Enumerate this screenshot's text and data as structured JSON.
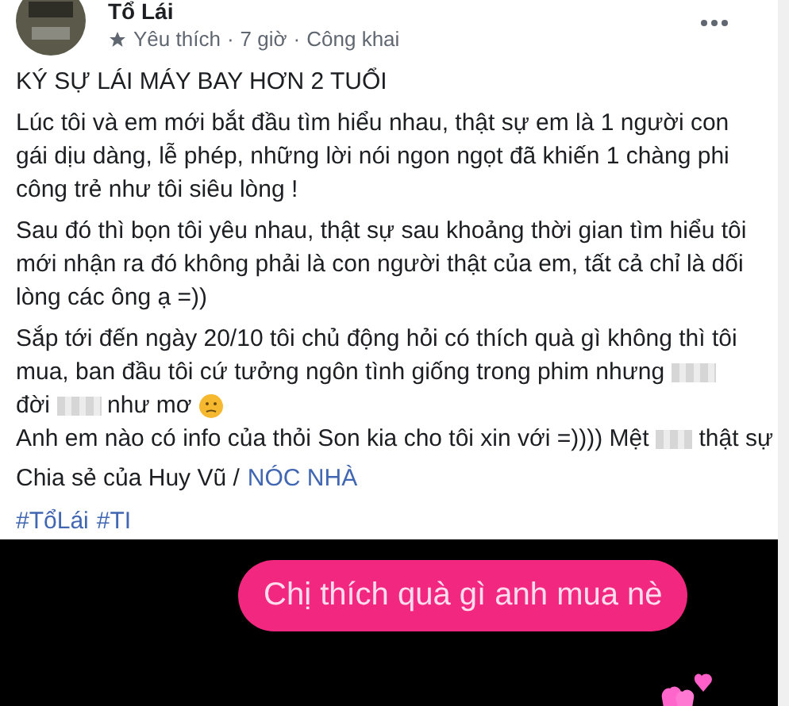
{
  "post": {
    "author": "Tổ Lái",
    "meta": {
      "badge": "Yêu thích",
      "time": "7 giờ",
      "privacy": "Công khai",
      "separator": "·"
    },
    "title": "KÝ SỰ LÁI MÁY BAY HƠN 2 TUỔI",
    "paragraphs": [
      {
        "lines": [
          [
            {
              "kind": "text",
              "text": "Lúc tôi và em mới bắt đầu tìm hiểu nhau, thật sự em là 1 người con"
            }
          ],
          [
            {
              "kind": "text",
              "text": "gái dịu dàng, lễ phép, những lời nói ngon ngọt đã khiến  1 chàng phi"
            }
          ],
          [
            {
              "kind": "text",
              "text": "công trẻ như tôi siêu lòng !"
            }
          ]
        ]
      },
      {
        "lines": [
          [
            {
              "kind": "text",
              "text": "Sau đó thì bọn tôi yêu nhau, thật sự sau khoảng thời gian tìm hiểu tôi"
            }
          ],
          [
            {
              "kind": "text",
              "text": "mới nhận ra đó không phải là con người thật của em, tất cả chỉ là dối"
            }
          ],
          [
            {
              "kind": "text",
              "text": "lòng các ông ạ =))"
            }
          ]
        ]
      },
      {
        "lines": [
          [
            {
              "kind": "text",
              "text": "Sắp tới đến ngày 20/10 tôi chủ động hỏi có thích quà gì không thì tôi"
            }
          ],
          [
            {
              "kind": "text",
              "text": "mua, ban đầu tôi cứ tưởng ngôn tình giống trong phim nhưng"
            },
            {
              "kind": "redacted"
            }
          ],
          [
            {
              "kind": "text",
              "text": "đời"
            },
            {
              "kind": "redacted"
            },
            {
              "kind": "text",
              "text": "như mơ"
            },
            {
              "kind": "emoji"
            }
          ],
          [
            {
              "kind": "text",
              "text": "Anh em nào có info của thỏi Son kia cho tôi xin với =)))) Mệt"
            },
            {
              "kind": "redacted"
            },
            {
              "kind": "text",
              "text": "thật sự"
            }
          ]
        ]
      }
    ],
    "credit": {
      "text": "Chia sẻ của Huy Vũ /",
      "link": "NÓC NHÀ"
    },
    "hashtags": [
      "#TổLái",
      "#TI"
    ]
  },
  "chat": {
    "message": "Chị thích quà gì anh mua nè"
  }
}
